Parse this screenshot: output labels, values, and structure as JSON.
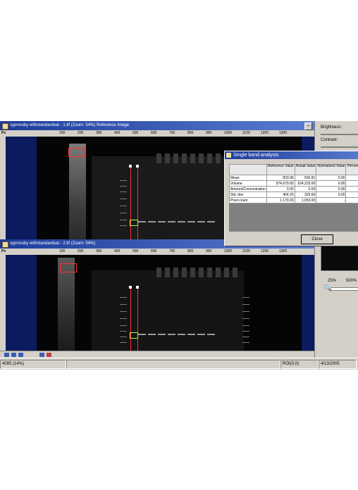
{
  "window1": {
    "title": "syproruby withstandardsat - 1.tif  (Zoom: 54%) Reference Image"
  },
  "window2": {
    "title": "syproruby withstandardsat - 2.tif  (Zoom: 54%)"
  },
  "ruler": {
    "corner_label": "Px",
    "ticks": [
      "100",
      "200",
      "300",
      "400",
      "500",
      "600",
      "700",
      "800",
      "900",
      "1000",
      "1100",
      "1200",
      "1300"
    ]
  },
  "right_panel": {
    "brightness_label": "Brightness:",
    "contrast_label": "Contrast:",
    "zoom_min": "25%",
    "zoom_max": "500%"
  },
  "dialog": {
    "title": "Single band analysis",
    "columns": [
      "",
      "Reference Value",
      "Actual Value",
      "Normalized Value",
      "Percent Difference"
    ],
    "rows": [
      [
        "Mean",
        "833.06",
        "592.81",
        "0.00",
        "0."
      ],
      [
        "Volume",
        "974,679.00",
        "624,233.00",
        "0.00",
        "0."
      ],
      [
        "Amount/Concentration",
        "0.00",
        "0.00",
        "0.00",
        "0."
      ],
      [
        "Std. dev",
        "464.20",
        "326.60",
        "0.00",
        ""
      ],
      [
        "Pixel count",
        "1,170.00",
        "1,053.00",
        "-",
        ""
      ]
    ],
    "close_label": "Close"
  },
  "status": {
    "left": "4095 (14%)",
    "roi": "ROI(0,0)",
    "date": "4/13/2005"
  },
  "colors": {
    "titlebar": "#1c3c9a",
    "roi": "#ff3030",
    "band_roi": "#a0ff40",
    "canvas_frame": "#0c1a60"
  }
}
